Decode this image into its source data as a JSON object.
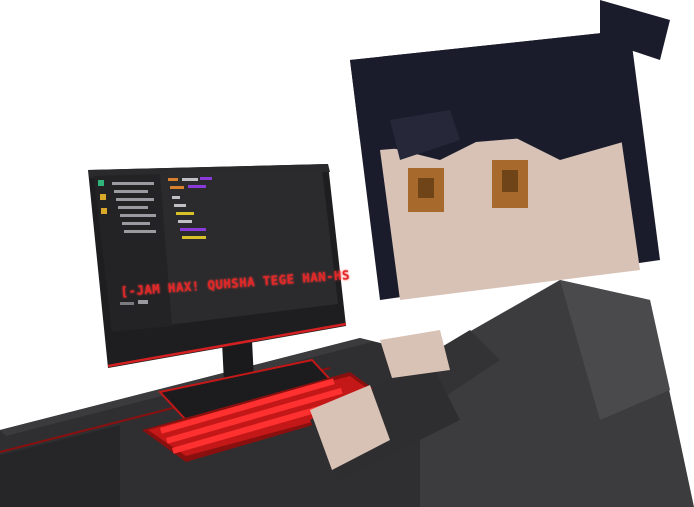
{
  "scene": {
    "banner_text": "[-JAM HAX! QUHSHA TEGE HAN-HS",
    "colors": {
      "accent_red": "#e02828",
      "desk": "#2f2f31",
      "monitor_frame": "#1e1e20",
      "screen_bg": "#2b2b2d",
      "hair": "#1a1c2c",
      "skin": "#d8c2b6",
      "eyes": "#a8692c",
      "shirt": "#3c3c3e"
    },
    "icons": [
      "character-icon",
      "monitor-icon",
      "keyboard-icon",
      "desk-icon"
    ]
  }
}
